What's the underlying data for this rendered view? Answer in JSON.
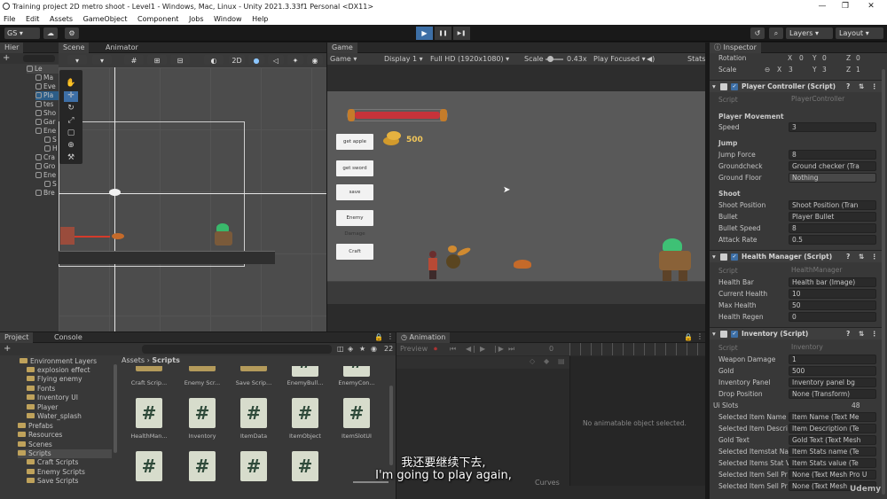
{
  "window": {
    "title": "Training project 2D metro shoot - Level1 - Windows, Mac, Linux - Unity 2021.3.33f1 Personal <DX11>",
    "controls": [
      "—",
      "❐",
      "✕"
    ]
  },
  "menu": [
    "File",
    "Edit",
    "Assets",
    "GameObject",
    "Component",
    "Jobs",
    "Window",
    "Help"
  ],
  "toolbar": {
    "account": "GS",
    "layers": "Layers",
    "layout": "Layout",
    "play": "▶",
    "pause": "❚❚",
    "step": "▶❚"
  },
  "hierarchy": {
    "tab": "Hier",
    "items": [
      "Le",
      "Ma",
      "Eve",
      "Pla",
      "tes",
      "Sho",
      "Gar",
      "Ene",
      "S",
      "H",
      "Cra",
      "Gro",
      "Ene",
      "S",
      "Bre"
    ]
  },
  "scene": {
    "tabs": [
      "Scene",
      "Animator"
    ],
    "mode_2d": "2D"
  },
  "game": {
    "tab": "Game",
    "view": "Game",
    "display": "Display 1",
    "resolution": "Full HD (1920x1080)",
    "scale_label": "Scale",
    "scale_value": "0.43x",
    "play_focused": "Play Focused",
    "stats": "Stats",
    "gold": "500",
    "health_fill": 1.0,
    "buttons": [
      "get apple",
      "get sword",
      "save",
      "Enemy Damage",
      "Craft"
    ]
  },
  "inspector": {
    "tab": "Inspector",
    "rotation_label": "Rotation",
    "rotation": {
      "x": "0",
      "y": "0",
      "z": "0"
    },
    "scale_label": "Scale",
    "scale": {
      "x": "3",
      "y": "3",
      "z": "1"
    },
    "player_controller": {
      "title": "Player Controller (Script)",
      "script_label": "Script",
      "script": "PlayerController",
      "movement_header": "Player Movement",
      "speed_label": "Speed",
      "speed": "3",
      "jump_header": "Jump",
      "jump_force_label": "Jump Force",
      "jump_force": "8",
      "groundcheck_label": "Groundcheck",
      "groundcheck": "Ground checker (Tra",
      "ground_floor_label": "Ground Floor",
      "ground_floor": "Nothing",
      "shoot_header": "Shoot",
      "shoot_position_label": "Shoot Position",
      "shoot_position": "Shoot Position (Tran",
      "bullet_label": "Bullet",
      "bullet": "Player Bullet",
      "bullet_speed_label": "Bullet Speed",
      "bullet_speed": "8",
      "attack_rate_label": "Attack Rate",
      "attack_rate": "0.5"
    },
    "health_manager": {
      "title": "Health Manager (Script)",
      "script_label": "Script",
      "script": "HealthManager",
      "health_bar_label": "Health Bar",
      "health_bar": "Health bar (Image)",
      "current_health_label": "Current Health",
      "current_health": "10",
      "max_health_label": "Max Health",
      "max_health": "50",
      "health_regen_label": "Health Regen",
      "health_regen": "0"
    },
    "inventory": {
      "title": "Inventory (Script)",
      "script_label": "Script",
      "script": "Inventory",
      "weapon_damage_label": "Weapon Damage",
      "weapon_damage": "1",
      "gold_label": "Gold",
      "gold": "500",
      "inventory_panel_label": "Inventory Panel",
      "inventory_panel": "Inventory panel bg",
      "drop_position_label": "Drop Position",
      "drop_position": "None (Transform)",
      "ui_slots_label": "Ui Slots",
      "ui_slots": "48",
      "selected_item_name_label": "Selected Item Name",
      "selected_item_name": "Item Name (Text Me",
      "selected_item_desc_label": "Selected Item Descri",
      "selected_item_desc": "Item Description (Te",
      "gold_text_label": "Gold Text",
      "gold_text": "Gold Text (Text Mesh",
      "selected_itemstat_label": "Selected Itemstat Na",
      "selected_itemstat": "Item Stats name (Te",
      "selected_items_stat_label": "Selected Items Stat V",
      "selected_items_stat": "Item Stats value (Te",
      "selected_item_sell_label": "Selected Item Sell Pr",
      "selected_item_sell": "None (Text Mesh Pro U",
      "selected_item_sell2_label": "Selected Item Sell Pr",
      "selected_item_sell2": "None (Text Mesh"
    }
  },
  "project": {
    "tabs": [
      "Project",
      "Console"
    ],
    "tree": [
      {
        "label": "Environment Layers",
        "indent": 2
      },
      {
        "label": "explosion effect",
        "indent": 2
      },
      {
        "label": "Flying enemy",
        "indent": 2
      },
      {
        "label": "Fonts",
        "indent": 2
      },
      {
        "label": "Inventory UI",
        "indent": 2
      },
      {
        "label": "Player",
        "indent": 2
      },
      {
        "label": "Water_splash",
        "indent": 2
      },
      {
        "label": "Prefabs",
        "indent": 1
      },
      {
        "label": "Resources",
        "indent": 1
      },
      {
        "label": "Scenes",
        "indent": 1
      },
      {
        "label": "Scripts",
        "indent": 1
      },
      {
        "label": "Craft Scripts",
        "indent": 2
      },
      {
        "label": "Enemy Scripts",
        "indent": 2
      },
      {
        "label": "Save Scripts",
        "indent": 2
      }
    ],
    "breadcrumb": [
      "Assets",
      "Scripts"
    ],
    "count": "22",
    "top_row": [
      "Craft Scrip...",
      "Enemy Scr...",
      "Save Scrip...",
      "EnemyBull...",
      "EnemyCon..."
    ],
    "scripts": [
      "HealthMan...",
      "Inventory",
      "ItemData",
      "ItemObject",
      "ItemSlotUI"
    ]
  },
  "animation": {
    "tab": "Animation",
    "preview": "Preview",
    "frame": "0",
    "empty": "No animatable object selected.",
    "curves": "Curves"
  },
  "subtitles": {
    "zh": "我还要继续下去,",
    "en": "I'm going to play again,"
  },
  "watermark": "Udemy"
}
